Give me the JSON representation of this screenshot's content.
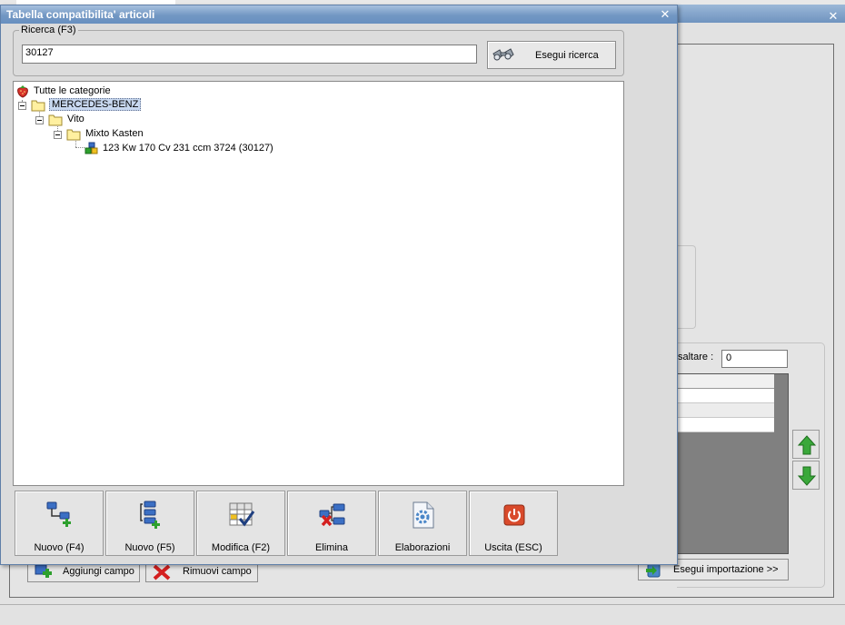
{
  "background_window": {
    "close_glyph": "✕",
    "skip_label": "saltare :",
    "skip_value": "0",
    "add_field_label": "Aggiungi campo",
    "remove_field_label": "Rimuovi campo",
    "import_label": "Esegui importazione >>"
  },
  "dialog": {
    "title": "Tabella compatibilita' articoli",
    "close_glyph": "✕",
    "search": {
      "legend": "Ricerca (F3)",
      "value": "30127",
      "button_label": "Esegui ricerca"
    },
    "tree": {
      "root_label": "Tutte le categorie",
      "make_label": "MERCEDES-BENZ",
      "model_label": "Vito",
      "variant_label": "Mixto Kasten",
      "engine_label": "123 Kw 170 Cv 231 ccm 3724 (30127)"
    },
    "toolbar": {
      "new_f4": "Nuovo (F4)",
      "new_f5": "Nuovo (F5)",
      "edit_f2": "Modifica (F2)",
      "delete": "Elimina",
      "processing": "Elaborazioni",
      "exit": "Uscita (ESC)"
    }
  },
  "colors": {
    "titlebar": "#7297c3",
    "selection": "#c8d8f0",
    "arrow_green": "#3aa83a",
    "exit_red": "#d94a2b",
    "delete_red": "#d42020"
  }
}
